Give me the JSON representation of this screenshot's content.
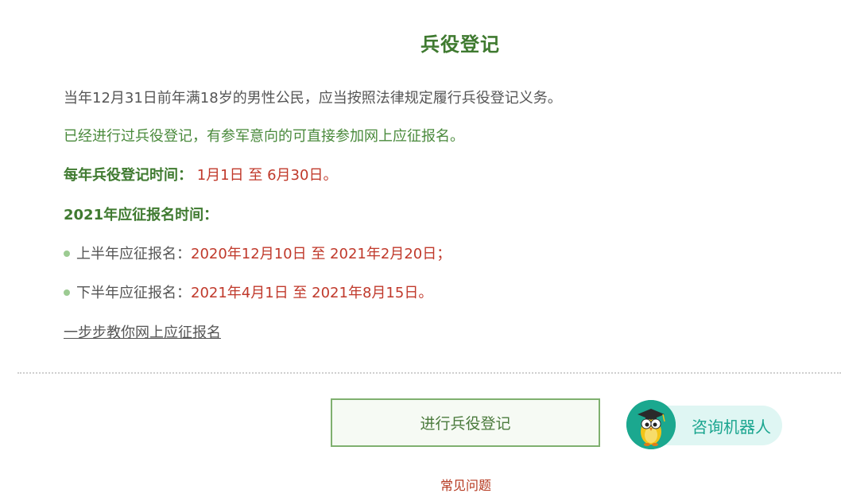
{
  "title": "兵役登记",
  "intro": {
    "line1": "当年12月31日前年满18岁的男性公民，应当按照法律规定履行兵役登记义务。",
    "line2": "已经进行过兵役登记，有参军意向的可直接参加网上应征报名。"
  },
  "registration_period": {
    "label": "每年兵役登记时间：",
    "value": "1月1日 至 6月30日。"
  },
  "enlistment": {
    "heading": "2021年应征报名时间：",
    "items": [
      {
        "label": "上半年应征报名：",
        "value": "2020年12月10日 至 2021年2月20日；"
      },
      {
        "label": "下半年应征报名：",
        "value": "2021年4月1日 至 2021年8月15日。"
      }
    ]
  },
  "guide_link": "一步步教你网上应征报名",
  "register_button": "进行兵役登记",
  "bot": {
    "label": "咨询机器人",
    "avatar_icon": "owl-mascot-icon"
  },
  "faq_link": "常见问题",
  "colors": {
    "title_green": "#3f7a30",
    "text_green": "#4a8a3c",
    "date_red": "#c0392b",
    "bot_teal": "#1aa58f"
  }
}
